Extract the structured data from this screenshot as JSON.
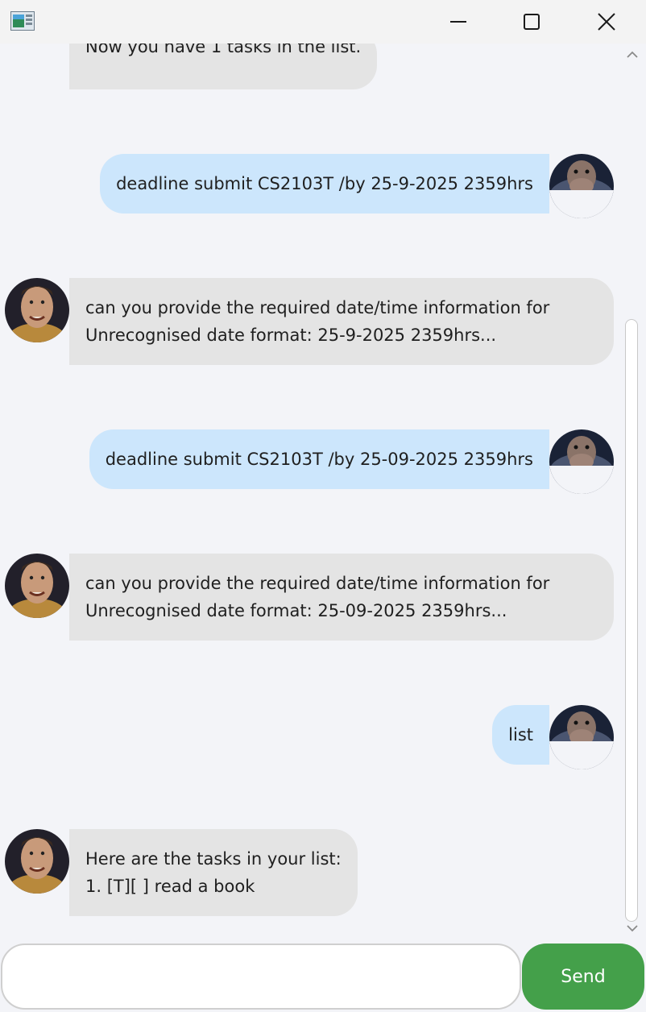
{
  "window": {
    "minimize_icon": "minimize-icon",
    "maximize_icon": "maximize-icon",
    "close_icon": "close-icon"
  },
  "colors": {
    "duke_bubble": "#e4e4e4",
    "user_bubble": "#cce6fc",
    "send_button": "#44a04a",
    "background": "#f3f4f8"
  },
  "messages": [
    {
      "sender": "duke",
      "text": "Now you have 1 tasks in the list."
    },
    {
      "sender": "user",
      "text": "deadline submit CS2103T /by 25-9-2025 2359hrs"
    },
    {
      "sender": "duke",
      "text": "can you provide the required date/time information for\nUnrecognised date format: 25-9-2025 2359hrs..."
    },
    {
      "sender": "user",
      "text": "deadline submit CS2103T /by 25-09-2025 2359hrs"
    },
    {
      "sender": "duke",
      "text": "can you provide the required date/time information for\nUnrecognised date format: 25-09-2025 2359hrs..."
    },
    {
      "sender": "user",
      "text": "list"
    },
    {
      "sender": "duke",
      "text": "Here are the tasks in your list:\n1. [T][ ] read a book"
    }
  ],
  "input": {
    "value": "",
    "placeholder": ""
  },
  "send_button": {
    "label": "Send"
  }
}
